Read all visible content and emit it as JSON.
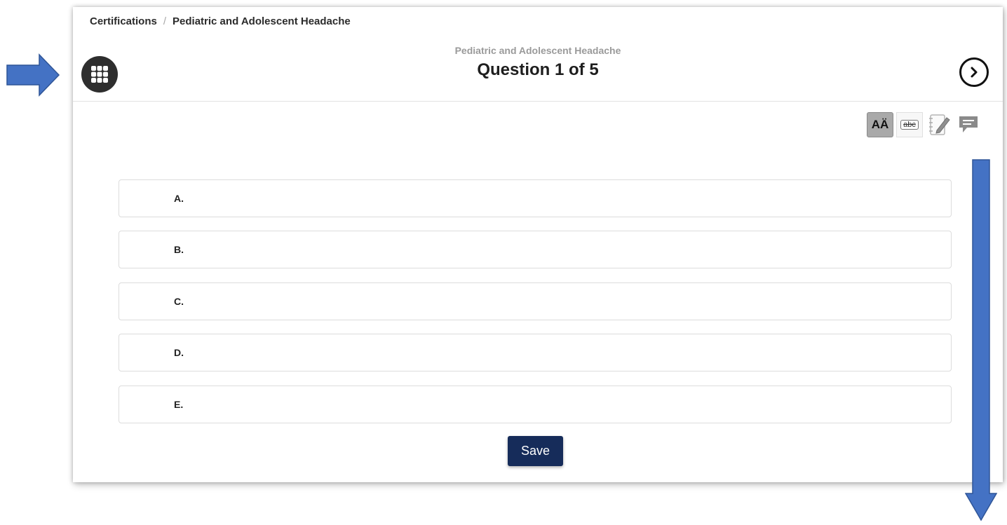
{
  "breadcrumb": {
    "root": "Certifications",
    "separator": "/",
    "current": "Pediatric and Adolescent Headache"
  },
  "header": {
    "subtitle": "Pediatric and Adolescent Headache",
    "title": "Question 1 of 5",
    "grid_icon": "grid-menu-icon",
    "next_icon": "chevron-right-circle-icon"
  },
  "toolbar": {
    "font_size_label": "AÄ",
    "strikethrough_label": "abc",
    "notes_icon": "notepad-pencil-icon",
    "comment_icon": "comment-icon"
  },
  "options": [
    {
      "letter": "A."
    },
    {
      "letter": "B."
    },
    {
      "letter": "C."
    },
    {
      "letter": "D."
    },
    {
      "letter": "E."
    }
  ],
  "save_label": "Save",
  "colors": {
    "annotation_arrow": "#4472c4",
    "save_button": "#162c5a",
    "grid_button": "#2e2e2e"
  }
}
